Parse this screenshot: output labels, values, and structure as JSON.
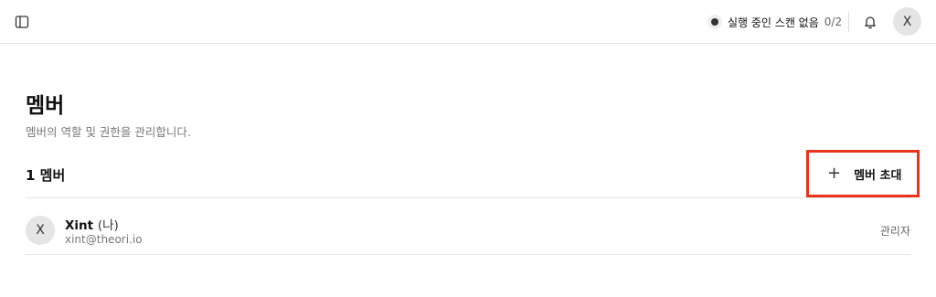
{
  "topbar": {
    "sidebar_toggle_icon": "sidebar-toggle-icon",
    "scan_status": {
      "text": "실행 중인 스캔 없음",
      "count": "0/2"
    },
    "notification_icon": "bell-icon",
    "user_avatar_initial": "X"
  },
  "page": {
    "title": "멤버",
    "subtitle": "멤버의 역할 및 권한을 관리합니다."
  },
  "members_section": {
    "count_label": "1 멤버",
    "invite_button": {
      "icon": "plus-icon",
      "plus_glyph": "+",
      "label": "멤버 초대"
    },
    "highlight_color": "#e8341c"
  },
  "members": [
    {
      "initial": "X",
      "name": "Xint",
      "you_tag": "(나)",
      "email": "xint@theori.io",
      "role": "관리자"
    }
  ]
}
